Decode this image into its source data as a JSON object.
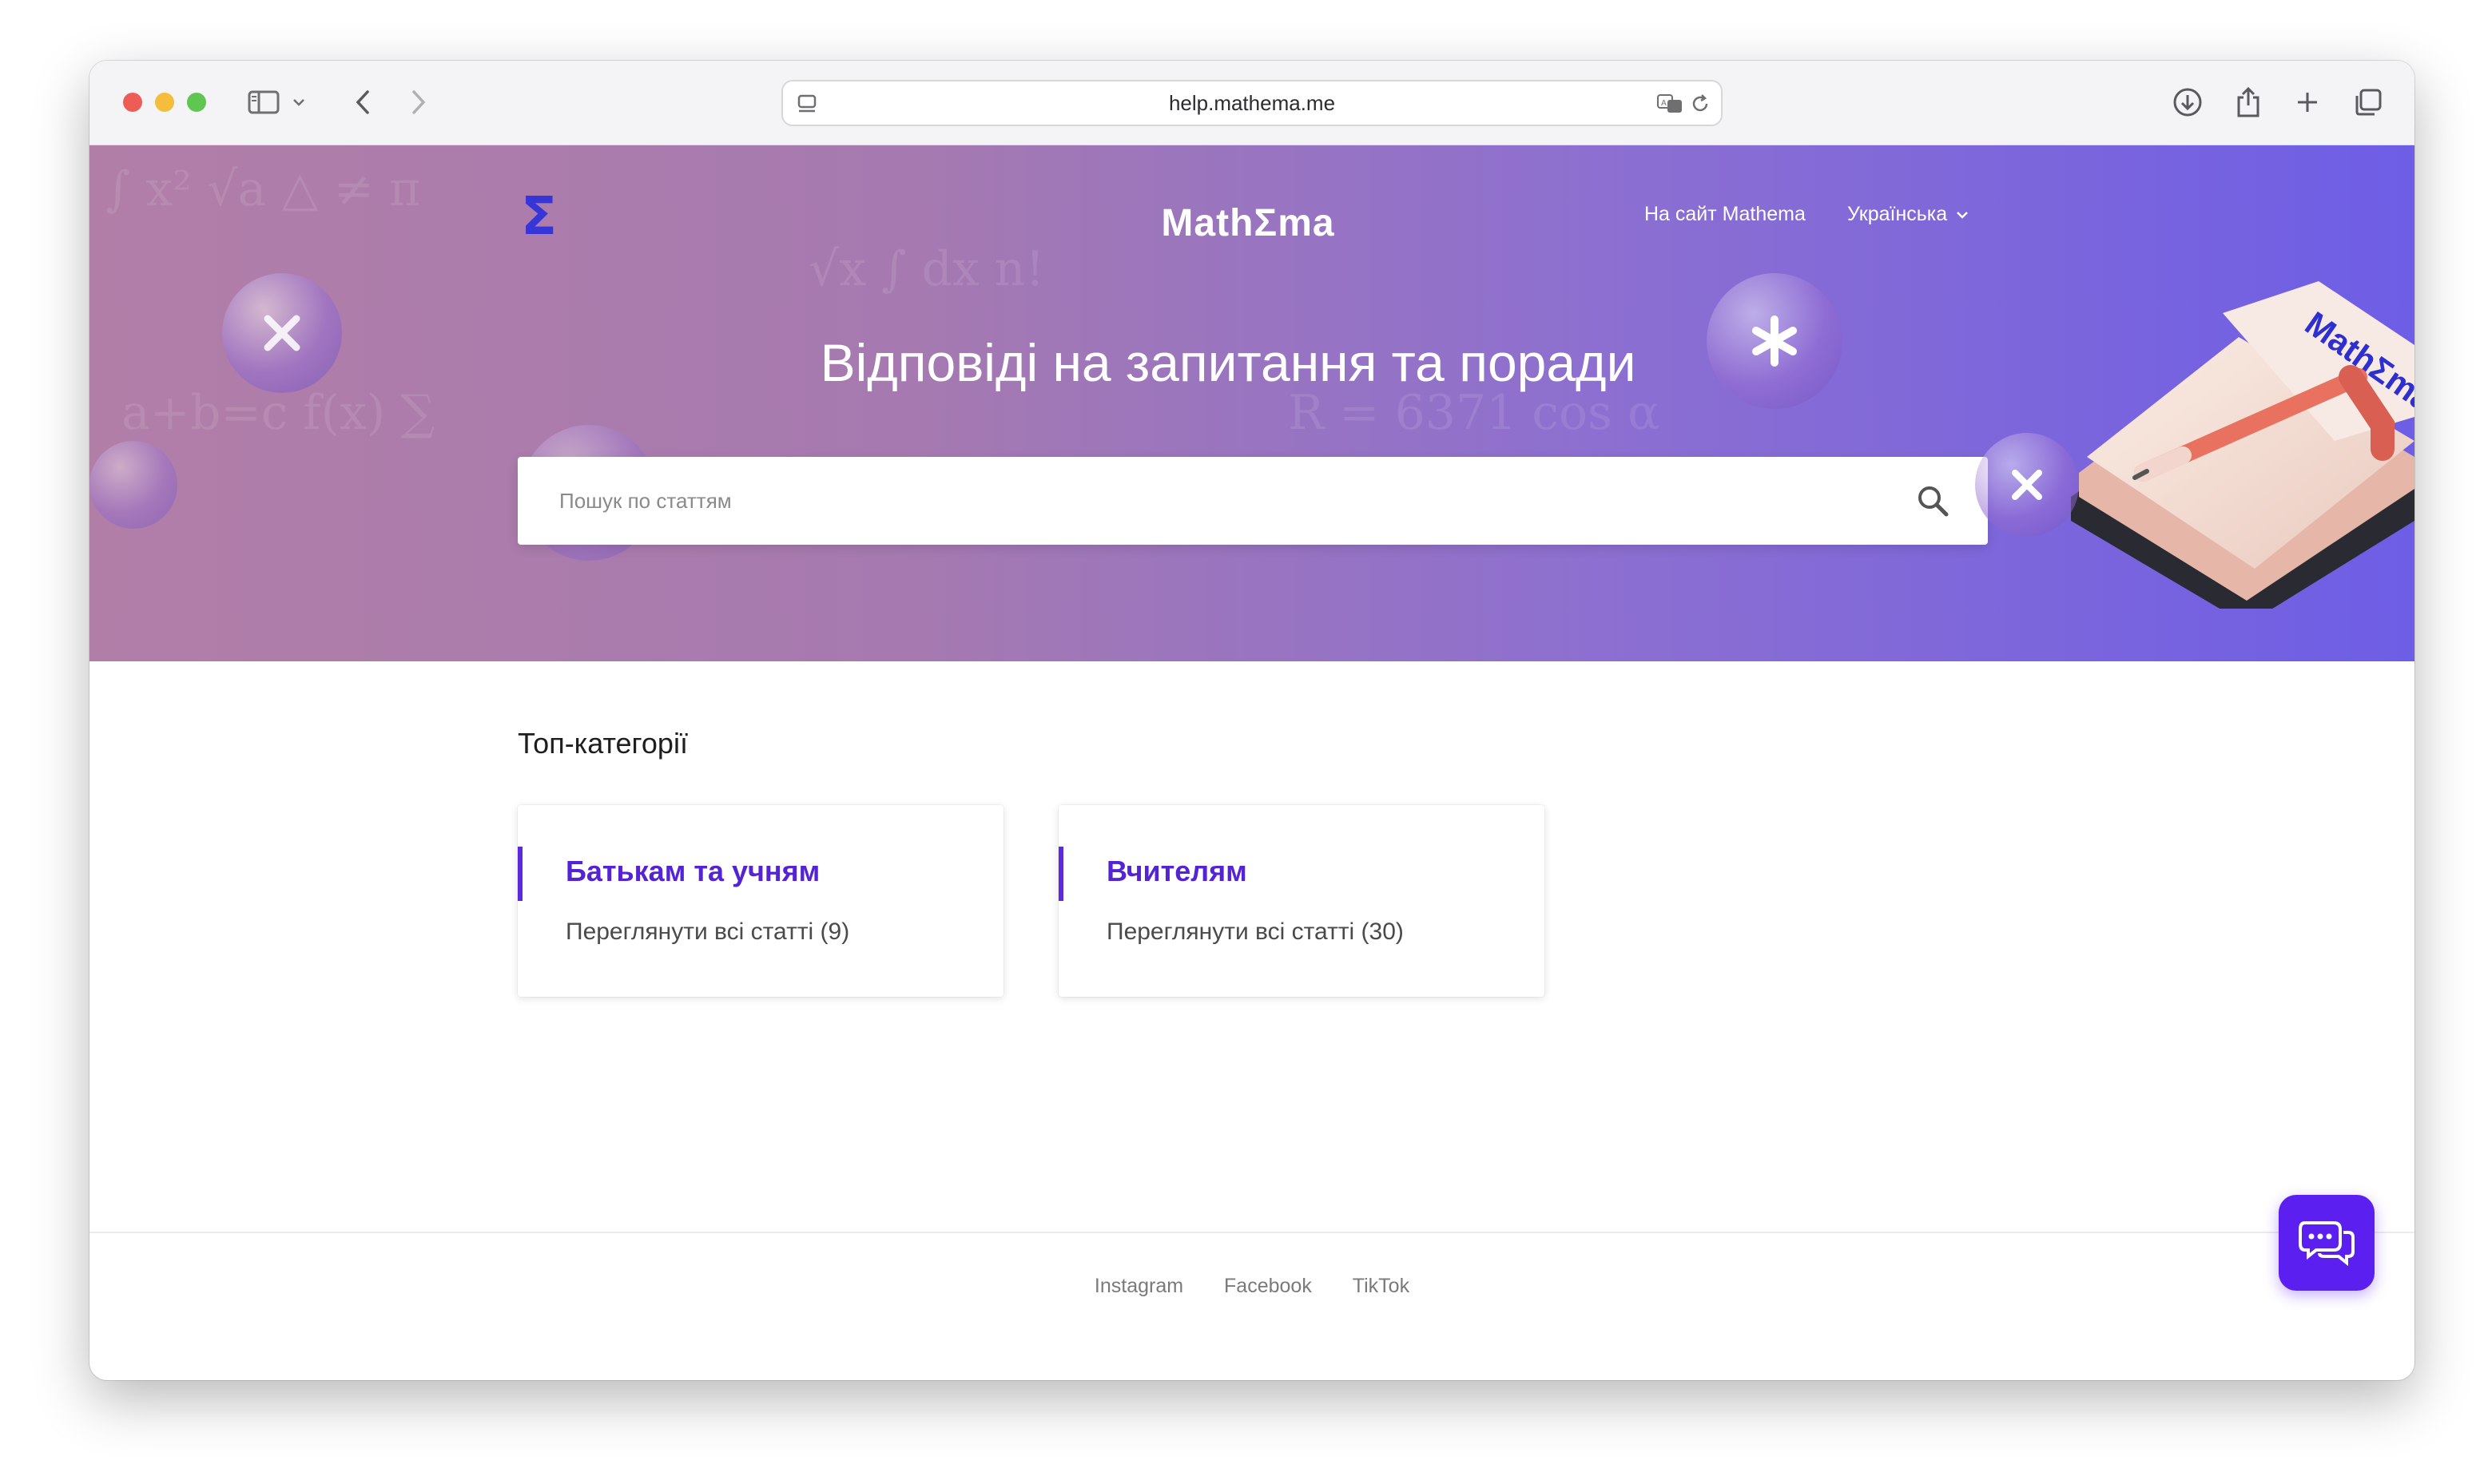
{
  "browser": {
    "url": "help.mathema.me"
  },
  "header": {
    "brand": "MathΣma",
    "logo_glyph": "Σ",
    "site_link": "На сайт Mathema",
    "language": "Українська"
  },
  "hero": {
    "title": "Відповіді на запитання та поради",
    "search_placeholder": "Пошук по статтям",
    "notebook_label": "MathΣma"
  },
  "categories": {
    "title": "Топ-категорії",
    "items": [
      {
        "title": "Батькам та учням",
        "link": "Переглянути всі статті (9)"
      },
      {
        "title": "Вчителям",
        "link": "Переглянути всі статті (30)"
      }
    ]
  },
  "footer": {
    "links": [
      "Instagram",
      "Facebook",
      "TikTok"
    ]
  },
  "colors": {
    "accent": "#5423d4",
    "chat_button": "#5b1ff0",
    "hero_left": "#b17ea7",
    "hero_right": "#6e5ee6"
  },
  "icons": {
    "chat": "chat-bubbles-icon",
    "search": "search-icon",
    "language_caret": "chevron-down-icon"
  }
}
